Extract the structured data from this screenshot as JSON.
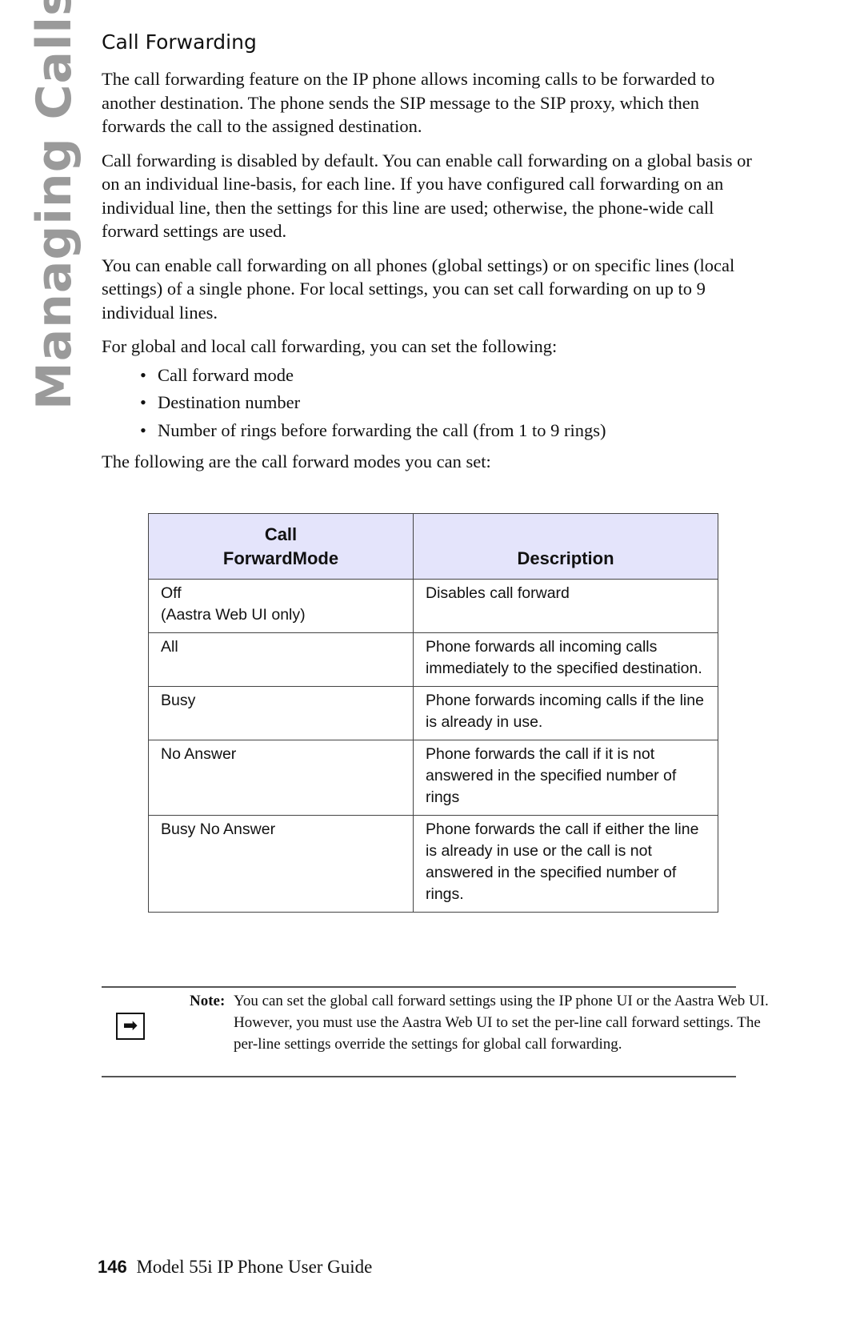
{
  "side_tab": "Managing Calls",
  "heading": "Call Forwarding",
  "paragraphs": [
    "The call forwarding feature on the IP phone allows incoming calls to be forwarded to another destination. The phone sends the SIP message to the SIP proxy, which then forwards the call to the assigned destination.",
    "Call forwarding is disabled by default. You can enable call forwarding on a global basis or on an individual line-basis, for each line.  If you have configured call forwarding on an individual line, then the settings for this line are used; otherwise, the phone-wide call forward settings are used.",
    "You can enable call forwarding on all phones (global settings) or on specific lines (local settings) of a single phone. For local settings, you can set call forwarding on up to 9 individual lines.",
    "For global and local call forwarding, you can set the following:"
  ],
  "bullets": [
    "Call forward mode",
    "Destination number",
    "Number of rings before forwarding the call (from 1 to 9 rings)"
  ],
  "table_intro": "The following are the call forward modes you can set:",
  "table": {
    "header_color": "#e4e4fb",
    "headers": {
      "mode_line1": "Call",
      "mode_line2": "ForwardMode",
      "description": "Description"
    },
    "rows": [
      {
        "mode": "Off",
        "mode_note": "(Aastra Web UI only)",
        "description": "Disables call forward"
      },
      {
        "mode": "All",
        "mode_note": "",
        "description": "Phone forwards all incoming calls immediately to the specified destination."
      },
      {
        "mode": "Busy",
        "mode_note": "",
        "description": "Phone forwards incoming calls if the line is already in use."
      },
      {
        "mode": "No Answer",
        "mode_note": "",
        "description": "Phone forwards the call if it is not answered in the specified number of rings"
      },
      {
        "mode": "Busy No Answer",
        "mode_note": "",
        "description": "Phone forwards the call if either the line is already in use or the call is not answered in the specified number of rings."
      }
    ]
  },
  "note": {
    "icon": "arrow-right-icon",
    "icon_glyph": "➡",
    "label": "Note:",
    "text": "You can set the global call forward settings using the IP phone UI or the Aastra Web UI. However, you must use the Aastra Web UI to set the per-line call forward settings. The per-line settings override the settings for global call forwarding."
  },
  "footer": {
    "page_number": "146",
    "title": "Model 55i IP Phone User Guide"
  }
}
